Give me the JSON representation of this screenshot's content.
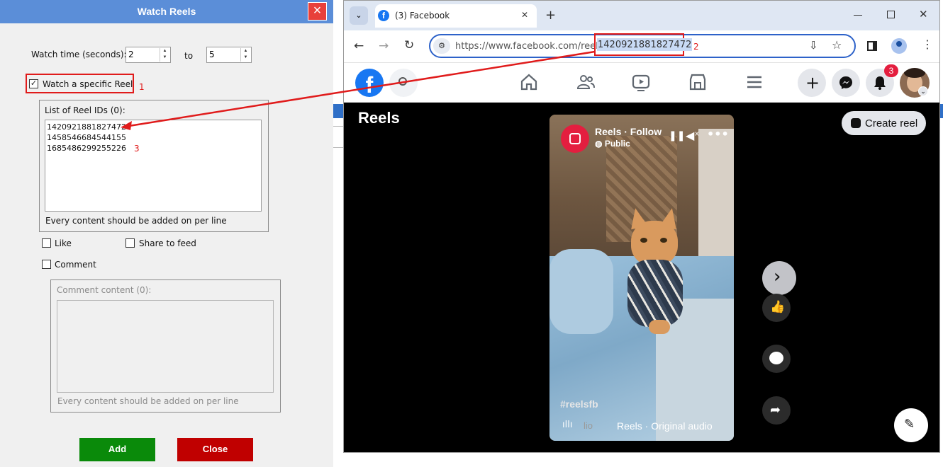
{
  "dialog": {
    "title": "Watch Reels",
    "close_icon": "×",
    "watch_time_label": "Watch time (seconds):",
    "watch_time_from": "2",
    "to_label": "to",
    "watch_time_to": "5",
    "watch_specific_label": "Watch a specific Reel",
    "watch_specific_checked": true,
    "annotation_1": "1",
    "reel_ids_label": "List of Reel IDs (0):",
    "reel_ids": [
      "1420921881827472",
      "1458546684544155",
      "1685486299255226"
    ],
    "annotation_3": "3",
    "reel_hint": "Every content should be added on per line",
    "like_label": "Like",
    "share_label": "Share to feed",
    "comment_label": "Comment",
    "comment_content_label": "Comment content (0):",
    "comment_hint": "Every content should be added on per line",
    "add_label": "Add",
    "close_label": "Close",
    "colors": {
      "titlebar": "#5b8ed8",
      "add": "#0a8a0a",
      "close": "#c00000",
      "annotation": "#e01b1b"
    }
  },
  "browser": {
    "tab_title": "(3) Facebook",
    "tab_close": "✕",
    "new_tab": "+",
    "url_prefix": "https://www.facebook.com/reel/",
    "url_id": "1420921881827472",
    "annotation_2": "2",
    "window_controls": [
      "minimize-icon",
      "maximize-icon",
      "close-icon"
    ],
    "notifications_count": "3",
    "page_title": "Reels",
    "create_reel_label": "Create reel",
    "reel": {
      "author": "Reels · Follow",
      "privacy": "Public",
      "hashtag": "#reelsfb",
      "audio_prefix": "lio",
      "audio": "Reels · Original audio"
    }
  }
}
